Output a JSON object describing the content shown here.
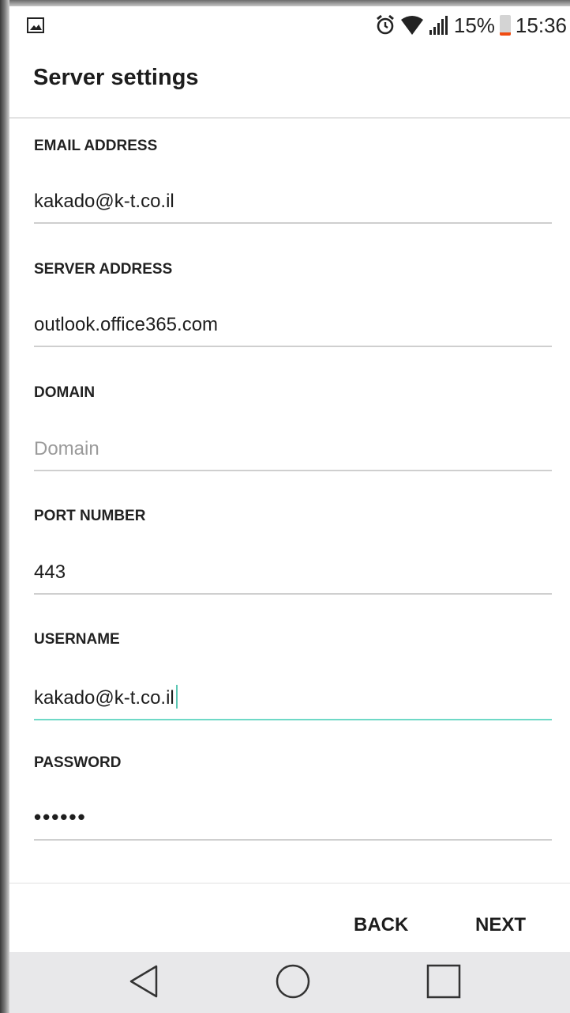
{
  "status_bar": {
    "battery_percent": "15%",
    "time": "15:36",
    "icons": [
      "gallery-icon",
      "alarm-icon",
      "wifi-icon",
      "signal-icon",
      "battery-icon"
    ],
    "battery_level": 0.15,
    "battery_color": "#f04c12"
  },
  "app_bar": {
    "title": "Server settings"
  },
  "form": {
    "email": {
      "label": "EMAIL ADDRESS",
      "value": "kakado@k-t.co.il"
    },
    "server": {
      "label": "SERVER ADDRESS",
      "value": "outlook.office365.com"
    },
    "domain": {
      "label": "DOMAIN",
      "value": "",
      "placeholder": "Domain"
    },
    "port": {
      "label": "PORT NUMBER",
      "value": "443"
    },
    "username": {
      "label": "USERNAME",
      "value": "kakado@k-t.co.il",
      "focused": true
    },
    "password": {
      "label": "PASSWORD",
      "value": "••••••"
    }
  },
  "buttons": {
    "back": "BACK",
    "next": "NEXT"
  },
  "colors": {
    "focus_underline": "#6fd9c7",
    "battery_low": "#f04c12"
  },
  "nav_bar": {
    "icons": [
      "back-triangle-icon",
      "home-circle-icon",
      "recents-square-icon"
    ]
  }
}
